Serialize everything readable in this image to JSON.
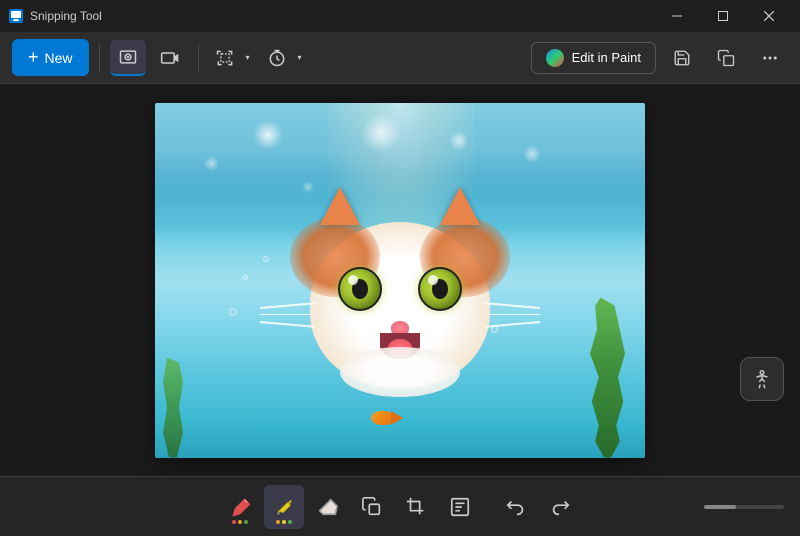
{
  "titleBar": {
    "title": "Snipping Tool",
    "minimize": "−",
    "maximize": "□",
    "close": "✕"
  },
  "toolbar": {
    "newButton": "New",
    "editInPaint": "Edit in Paint",
    "screenshotMode": "Screenshot mode",
    "videoMode": "Video mode",
    "regionSelect": "Region select",
    "timerMenu": "Timer menu",
    "saveIcon": "save",
    "copyIcon": "copy",
    "moreOptions": "More options"
  },
  "bottomTools": {
    "pen": "Pen tool",
    "highlighter": "Highlighter tool",
    "eraser": "Eraser tool",
    "copyRegion": "Copy region",
    "crop": "Crop",
    "textExtract": "Text extract",
    "undo": "Undo",
    "redo": "Redo"
  },
  "floatingBtn": {
    "label": "Screen reader / accessibility"
  }
}
